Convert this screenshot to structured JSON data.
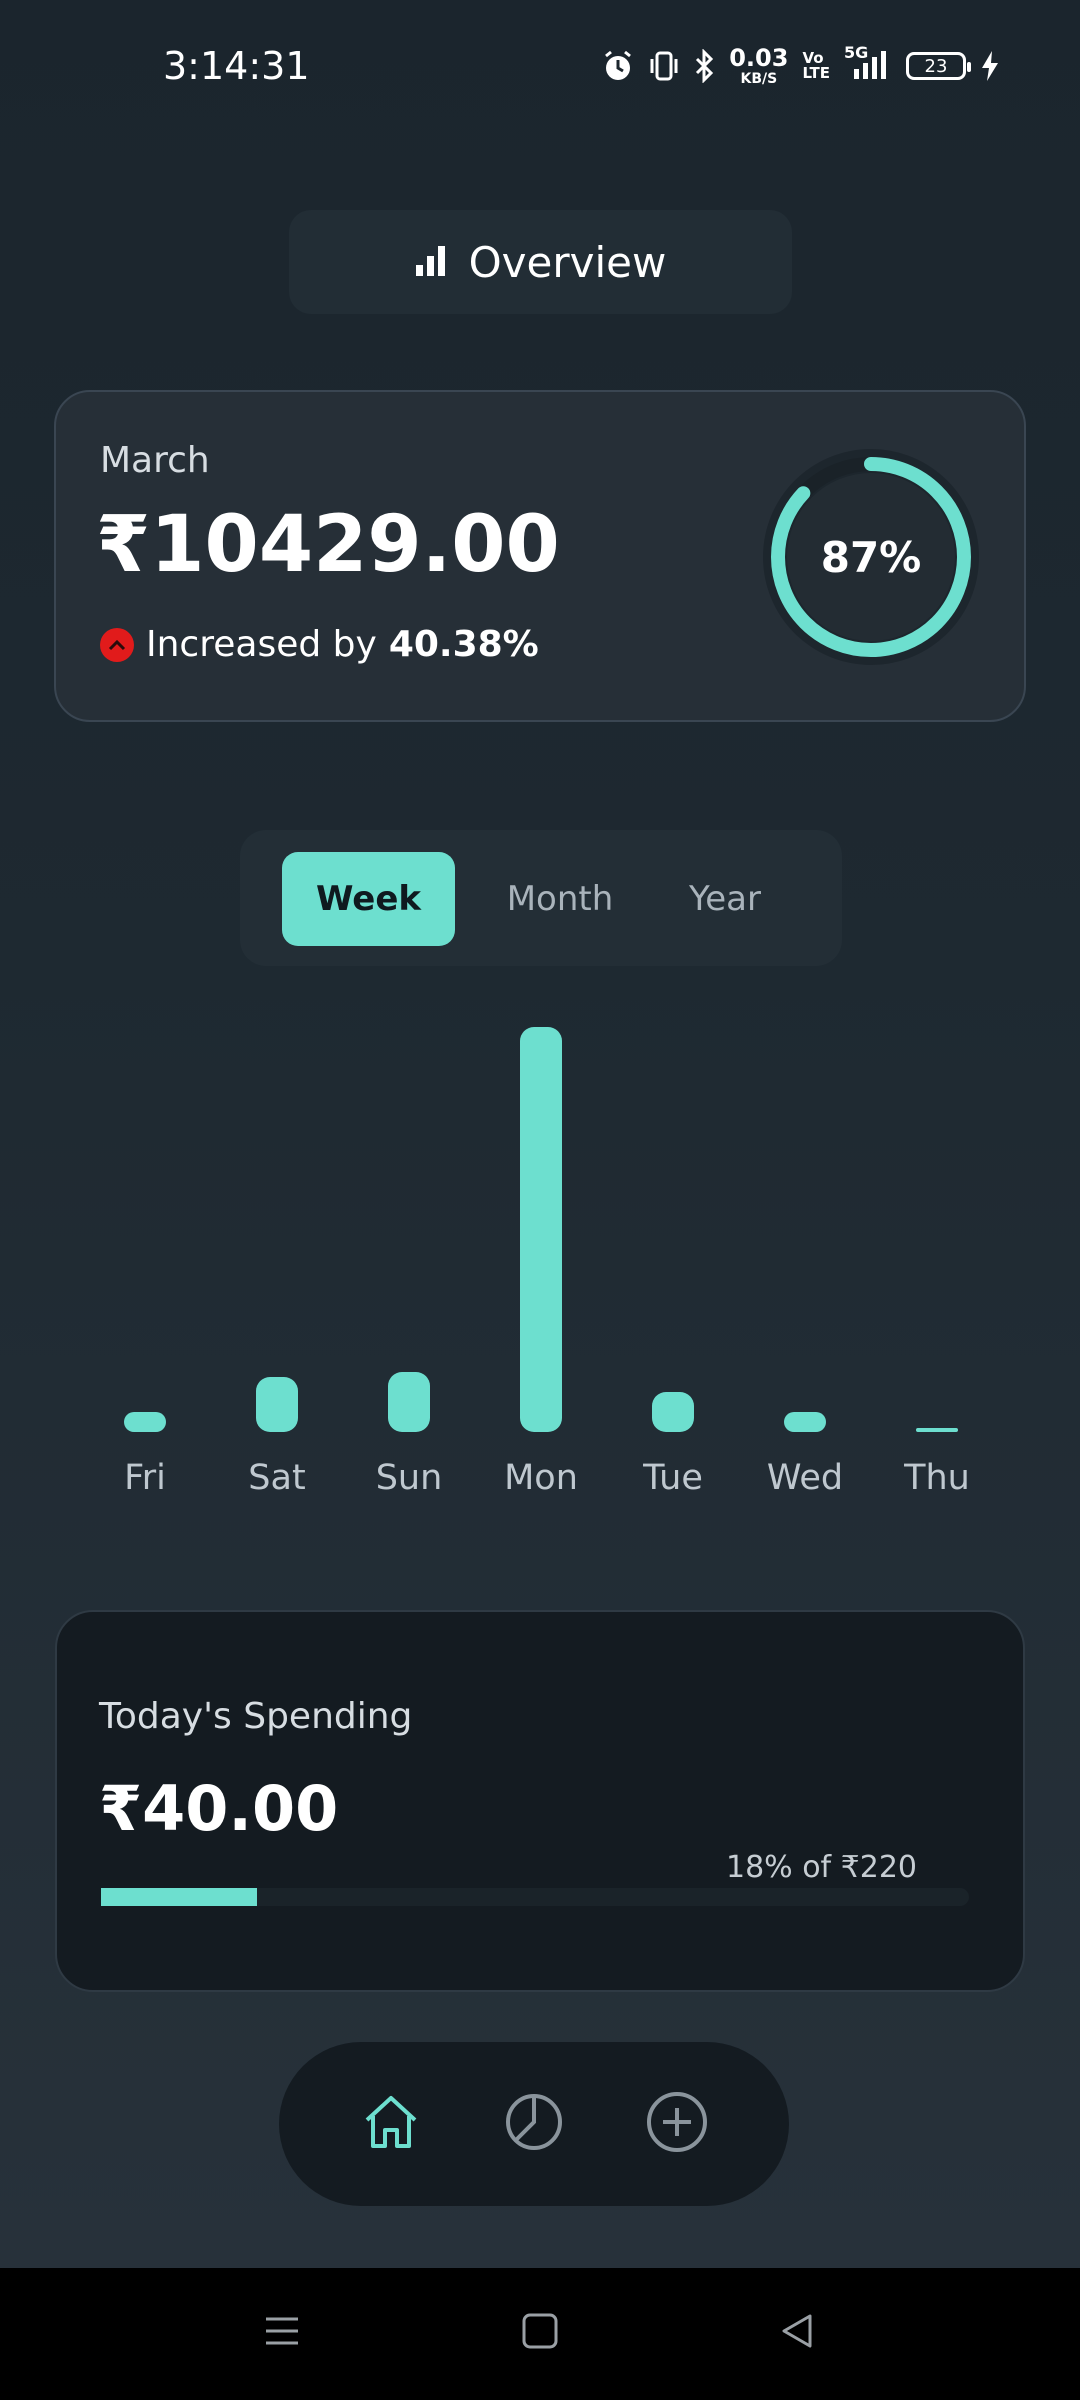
{
  "status_bar": {
    "time": "3:14:31",
    "net_speed": "0.03",
    "net_unit": "KB/S",
    "volte_top": "Vo",
    "volte_bottom": "LTE",
    "network_type": "5G",
    "battery": "23",
    "icons": [
      "alarm-icon",
      "vibrate-icon",
      "bluetooth-icon",
      "signal-icon",
      "battery-icon",
      "charging-icon"
    ]
  },
  "header": {
    "title": "Overview",
    "icon": "bar-chart-icon"
  },
  "month_card": {
    "month": "March",
    "amount": "₹10429.00",
    "change_prefix": "Increased by",
    "change_value": "40.38%",
    "progress_label": "87%",
    "progress_value": 0.87
  },
  "tabs": [
    "Week",
    "Month",
    "Year"
  ],
  "active_tab": "Week",
  "chart_data": {
    "type": "bar",
    "categories": [
      "Fri",
      "Sat",
      "Sun",
      "Mon",
      "Tue",
      "Wed",
      "Thu"
    ],
    "values": [
      20,
      55,
      60,
      405,
      40,
      20,
      4
    ],
    "ylim": [
      0,
      405
    ]
  },
  "today": {
    "title": "Today's Spending",
    "amount": "₹40.00",
    "percent_text": "18% of ₹220",
    "progress": 0.18
  },
  "bottom_nav": [
    {
      "name": "home",
      "icon": "home-icon",
      "active": true
    },
    {
      "name": "stats",
      "icon": "pie-chart-icon",
      "active": false
    },
    {
      "name": "add",
      "icon": "add-circle-icon",
      "active": false
    }
  ],
  "colors": {
    "accent": "#6ddfcf",
    "background": "#1e2931",
    "card": "#262f37",
    "dark_card": "#141b21",
    "increase_badge": "#e11b1b"
  }
}
